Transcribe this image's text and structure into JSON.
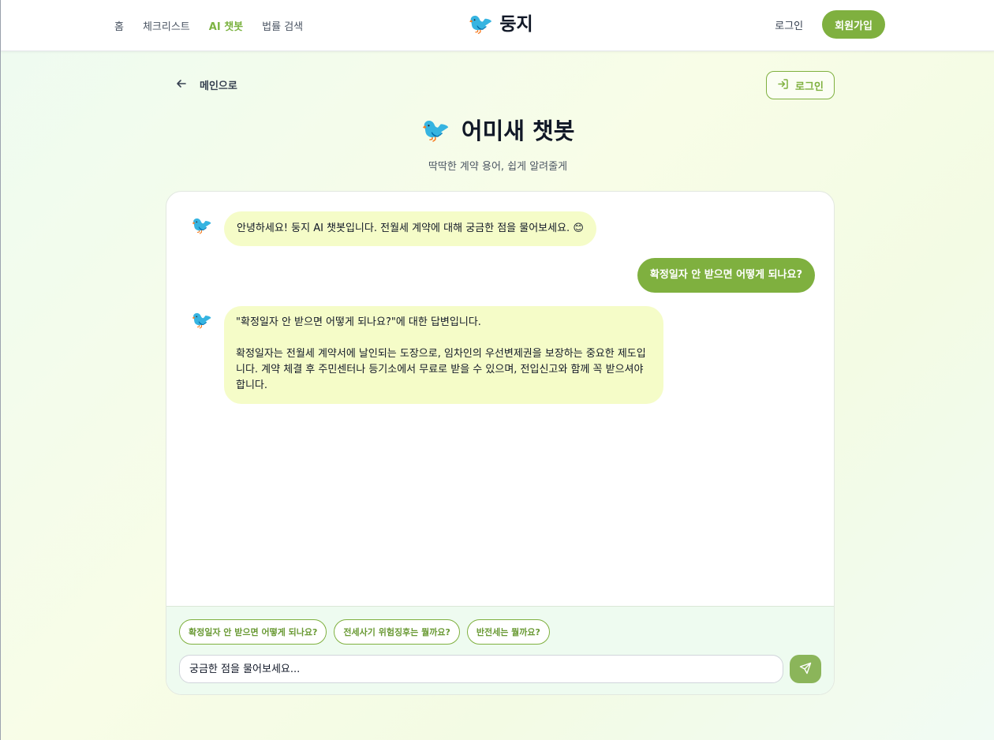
{
  "nav": {
    "items": [
      {
        "label": "홈"
      },
      {
        "label": "체크리스트"
      },
      {
        "label": "AI 챗봇",
        "active": true
      },
      {
        "label": "법률 검색"
      }
    ]
  },
  "brand": {
    "icon": "🐦",
    "name": "둥지"
  },
  "header": {
    "login_label": "로그인",
    "signup_label": "회원가입"
  },
  "subbar": {
    "back_label": "메인으로",
    "login_label": "로그인"
  },
  "page": {
    "title_icon": "🐦",
    "title": "어미새 챗봇",
    "subtitle": "딱딱한 계약 용어, 쉽게 알려줄게"
  },
  "messages": [
    {
      "role": "bot",
      "avatar": "🐦",
      "text": "안녕하세요! 둥지 AI 챗봇입니다. 전월세 계약에 대해 궁금한 점을 물어보세요. 😊"
    },
    {
      "role": "user",
      "text": "확정일자 안 받으면 어떻게 되나요?"
    },
    {
      "role": "bot",
      "avatar": "🐦",
      "line1": "\"확정일자 안 받으면 어떻게 되나요?\"에 대한 답변입니다.",
      "line2": "확정일자는 전월세 계약서에 날인되는 도장으로, 임차인의 우선변제권을 보장하는 중요한 제도입니다. 계약 체결 후 주민센터나 등기소에서 무료로 받을 수 있으며, 전입신고와 함께 꼭 받으셔야 합니다."
    }
  ],
  "suggestions": [
    "확정일자 안 받으면 어떻게 되나요?",
    "전세사기 위험징후는 뭘까요?",
    "반전세는 뭘까요?"
  ],
  "composer": {
    "placeholder": "궁금한 점을 물어보세요..."
  },
  "colors": {
    "accent": "#7fb03f",
    "bot_bubble": "#f5fcc8"
  }
}
